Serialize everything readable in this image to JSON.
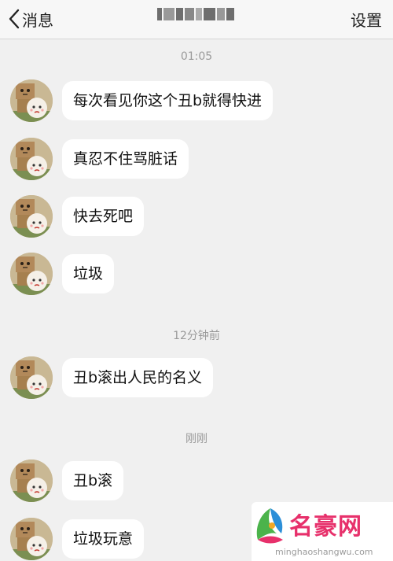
{
  "nav": {
    "back_label": "消息",
    "settings_label": "设置"
  },
  "timestamps": [
    "01:05",
    "12分钟前",
    "刚刚"
  ],
  "messages": [
    {
      "text": "每次看见你这个丑b就得快进"
    },
    {
      "text": "真忍不住骂脏话"
    },
    {
      "text": "快去死吧"
    },
    {
      "text": "垃圾"
    },
    {
      "text": "丑b滚出人民的名义"
    },
    {
      "text": "丑b滚"
    },
    {
      "text": "垃圾玩意"
    }
  ],
  "watermark": {
    "title": "名豪网",
    "subtitle": "minghaoshangwu.com"
  },
  "colors": {
    "background": "#f0f0f0",
    "bubble": "#ffffff",
    "timestamp": "#9a9a9a",
    "watermark_title": "#e7306b"
  }
}
